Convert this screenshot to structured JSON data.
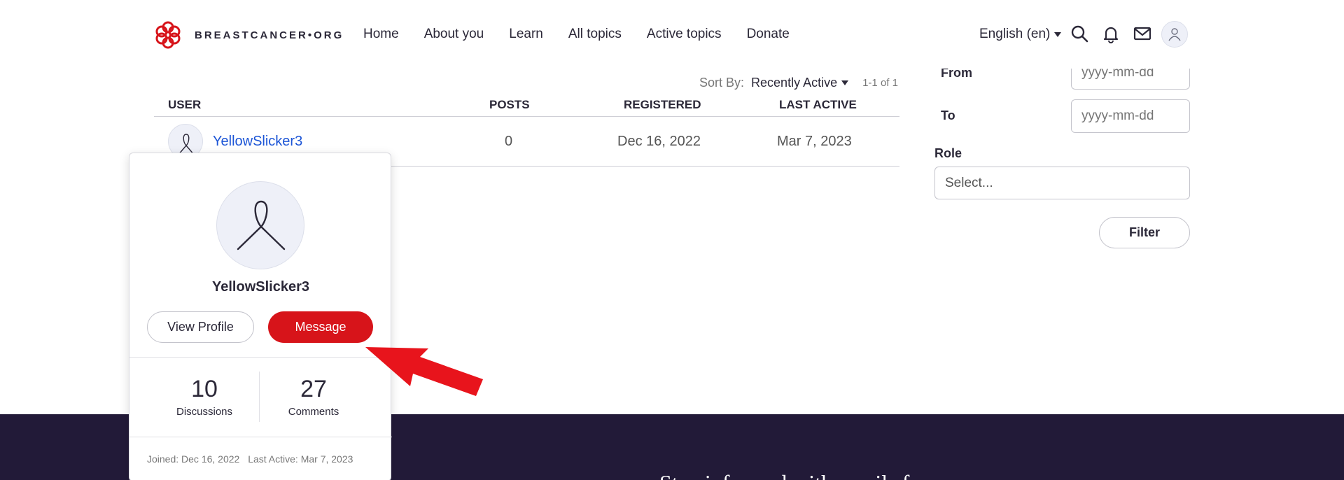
{
  "header": {
    "logo_text": "BREASTCANCER•ORG",
    "nav": [
      "Home",
      "About you",
      "Learn",
      "All topics",
      "Active topics",
      "Donate"
    ],
    "language": "English (en)",
    "icons": [
      "search-icon",
      "bell-icon",
      "mail-icon",
      "user-avatar-icon"
    ]
  },
  "sort": {
    "label": "Sort By:",
    "value": "Recently Active",
    "paging": "1-1 of 1"
  },
  "table": {
    "columns": [
      "USER",
      "POSTS",
      "REGISTERED",
      "LAST ACTIVE"
    ],
    "rows": [
      {
        "user": "YellowSlicker3",
        "posts": "0",
        "registered": "Dec 16, 2022",
        "last_active": "Mar 7, 2023"
      }
    ]
  },
  "filter": {
    "from_label": "From",
    "from_placeholder": "yyyy-mm-dd",
    "to_label": "To",
    "to_placeholder": "yyyy-mm-dd",
    "role_label": "Role",
    "role_value": "Select...",
    "button": "Filter"
  },
  "card": {
    "name": "YellowSlicker3",
    "view_profile": "View Profile",
    "message": "Message",
    "discussions_count": "10",
    "discussions_label": "Discussions",
    "comments_count": "27",
    "comments_label": "Comments",
    "joined": "Joined: Dec 16, 2022",
    "last_active": "Last Active: Mar 7, 2023"
  },
  "footer": {
    "text": "Stay informed with emails from"
  },
  "colors": {
    "brand_red": "#d7141a",
    "link_blue": "#1c55d6",
    "footer_bg": "#221a38",
    "arrow_red": "#e8141c"
  }
}
